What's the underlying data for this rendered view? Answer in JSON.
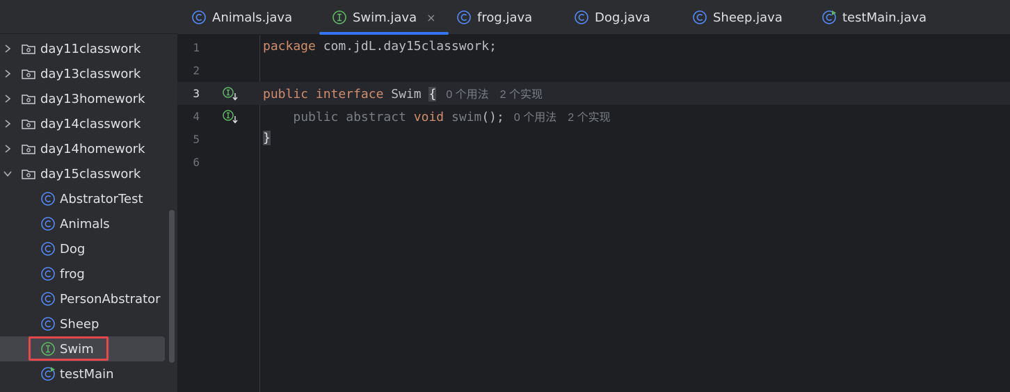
{
  "sidebar": {
    "packages": [
      {
        "label": "day11classwork",
        "expanded": false
      },
      {
        "label": "day13classwork",
        "expanded": false
      },
      {
        "label": "day13homework",
        "expanded": false
      },
      {
        "label": "day14classwork",
        "expanded": false
      },
      {
        "label": "day14homework",
        "expanded": false
      },
      {
        "label": "day15classwork",
        "expanded": true
      }
    ],
    "files": [
      {
        "label": "AbstratorTest",
        "kind": "class"
      },
      {
        "label": "Animals",
        "kind": "class"
      },
      {
        "label": "Dog",
        "kind": "class"
      },
      {
        "label": "frog",
        "kind": "class"
      },
      {
        "label": "PersonAbstrator",
        "kind": "class"
      },
      {
        "label": "Sheep",
        "kind": "class"
      },
      {
        "label": "Swim",
        "kind": "interface",
        "selected": true
      },
      {
        "label": "testMain",
        "kind": "runnable-class"
      }
    ]
  },
  "tabs": [
    {
      "label": "Animals.java",
      "kind": "class"
    },
    {
      "label": "Swim.java",
      "kind": "interface",
      "active": true,
      "close": "×"
    },
    {
      "label": "frog.java",
      "kind": "class"
    },
    {
      "label": "Dog.java",
      "kind": "class"
    },
    {
      "label": "Sheep.java",
      "kind": "class"
    },
    {
      "label": "testMain.java",
      "kind": "runnable-class"
    }
  ],
  "editor": {
    "line_numbers": [
      "1",
      "2",
      "3",
      "4",
      "5",
      "6"
    ],
    "current_line": 3,
    "line1": {
      "kw": "package",
      "rest": " com.jdL.day15classwork;"
    },
    "line3": {
      "kw1": "public",
      "kw2": "interface",
      "name": "Swim",
      "brace": "{",
      "hint_usages": "0 个用法",
      "hint_impls": "2 个实现"
    },
    "line4": {
      "mod1": "public",
      "mod2": "abstract",
      "kw": "void",
      "method": "swim",
      "tail": "();",
      "hint_usages": "0 个用法",
      "hint_impls": "2 个实现"
    },
    "line5": {
      "brace": "}"
    }
  },
  "colors": {
    "accent": "#3574f0",
    "keyword": "#cf8e6d",
    "class_icon": "#548af7",
    "interface_icon": "#5fb865",
    "selection_outline": "#e5484d"
  },
  "icons": {
    "class": "class-c-icon",
    "interface": "interface-i-icon",
    "runnable": "runnable-class-icon",
    "folder": "package-folder-icon",
    "chevron_right": "chevron-right-icon",
    "chevron_down": "chevron-down-icon",
    "implemented": "implemented-down-arrow-icon"
  }
}
